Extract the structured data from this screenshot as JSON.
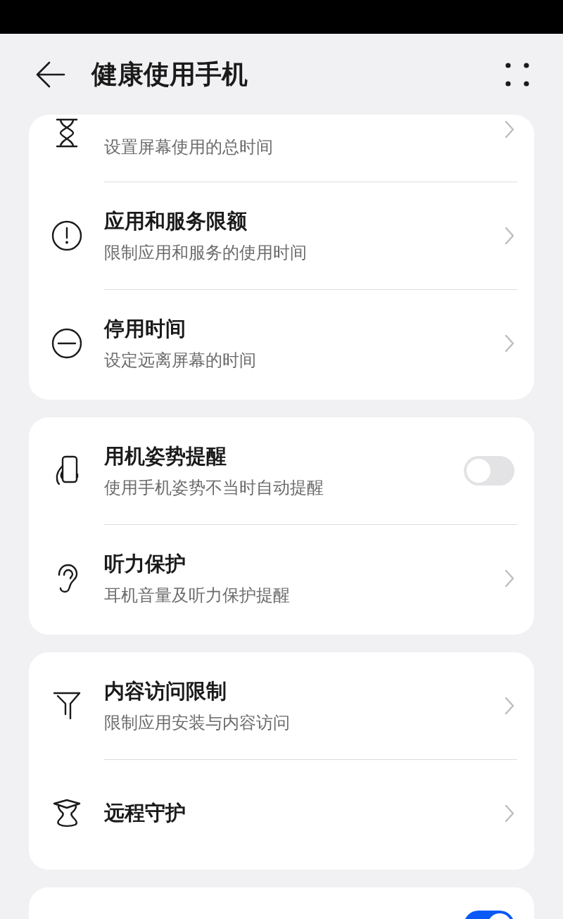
{
  "header": {
    "title": "健康使用手机"
  },
  "cards": [
    {
      "items": [
        {
          "kind": "link",
          "subtitle": "设置屏幕使用的总时间"
        },
        {
          "kind": "link",
          "title": "应用和服务限额",
          "subtitle": "限制应用和服务的使用时间"
        },
        {
          "kind": "link",
          "title": "停用时间",
          "subtitle": "设定远离屏幕的时间"
        }
      ]
    },
    {
      "items": [
        {
          "kind": "toggle",
          "title": "用机姿势提醒",
          "subtitle": "使用手机姿势不当时自动提醒",
          "on": false
        },
        {
          "kind": "link",
          "title": "听力保护",
          "subtitle": "耳机音量及听力保护提醒"
        }
      ]
    },
    {
      "items": [
        {
          "kind": "link",
          "title": "内容访问限制",
          "subtitle": "限制应用安装与内容访问"
        },
        {
          "kind": "link",
          "title": "远程守护"
        }
      ]
    },
    {
      "items": [
        {
          "kind": "toggle",
          "on": true
        }
      ]
    }
  ]
}
